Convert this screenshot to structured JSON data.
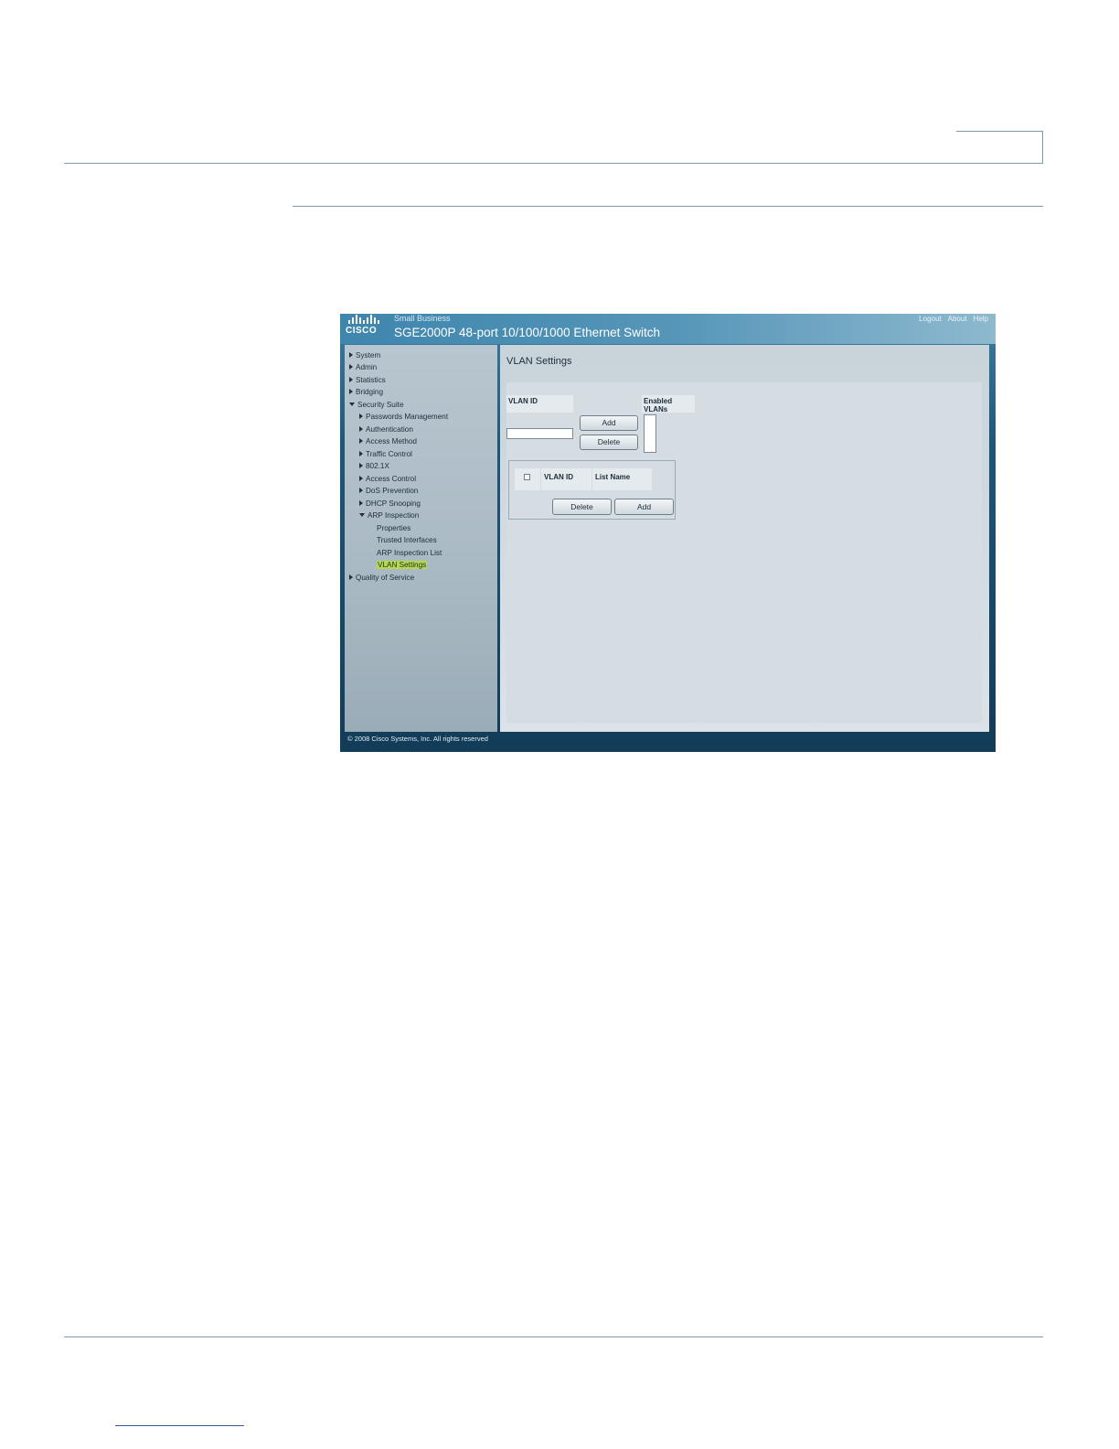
{
  "header": {
    "brand_sub": "Small Business",
    "title": "SGE2000P 48-port 10/100/1000 Ethernet Switch",
    "logo_text": "CISCO",
    "links": [
      "Logout",
      "About",
      "Help"
    ]
  },
  "sidebar": {
    "items": [
      {
        "label": "System"
      },
      {
        "label": "Admin"
      },
      {
        "label": "Statistics"
      },
      {
        "label": "Bridging"
      },
      {
        "label": "Security Suite"
      },
      {
        "label": "Passwords Management"
      },
      {
        "label": "Authentication"
      },
      {
        "label": "Access Method"
      },
      {
        "label": "Traffic Control"
      },
      {
        "label": "802.1X"
      },
      {
        "label": "Access Control"
      },
      {
        "label": "DoS Prevention"
      },
      {
        "label": "DHCP Snooping"
      },
      {
        "label": "ARP Inspection"
      },
      {
        "label": "Properties"
      },
      {
        "label": "Trusted Interfaces"
      },
      {
        "label": "ARP Inspection List"
      },
      {
        "label": "VLAN Settings"
      },
      {
        "label": "Quality of Service"
      }
    ]
  },
  "main": {
    "page_title": "VLAN Settings",
    "vlan_id_label": "VLAN ID",
    "vlan_id_value": "",
    "enabled_vlans_label": "Enabled VLANs",
    "add_label": "Add",
    "delete_label": "Delete",
    "table": {
      "columns": [
        "VLAN ID",
        "List Name"
      ]
    },
    "table_delete_label": "Delete",
    "table_add_label": "Add"
  },
  "footer": {
    "copyright": "© 2008 Cisco Systems, Inc. All rights reserved"
  },
  "colors": {
    "header_blue": "#3f86ad",
    "active_highlight": "#b6d84a",
    "rule_line": "#7a9bab"
  }
}
